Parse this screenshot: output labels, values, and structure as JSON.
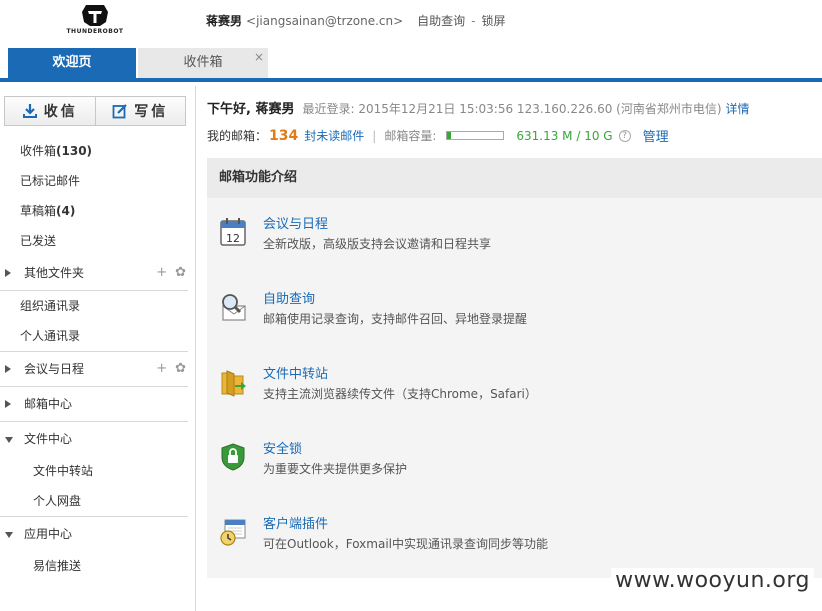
{
  "header": {
    "logo_text": "THUNDEROBOT",
    "user_name": "蒋赛男",
    "user_email": "<jiangsainan@trzone.cn>",
    "link_selfquery": "自助查询",
    "separator": "-",
    "link_lock": "锁屏"
  },
  "tabs": {
    "welcome": "欢迎页",
    "inbox": "收件箱",
    "close": "×"
  },
  "sidebar": {
    "receive_label": "收信",
    "write_label": "写信",
    "inbox_label": "收件箱",
    "inbox_count": "(130)",
    "starred": "已标记邮件",
    "drafts_label": "草稿箱",
    "drafts_count": "(4)",
    "sent": "已发送",
    "other_folders": "其他文件夹",
    "org_contacts": "组织通讯录",
    "personal_contacts": "个人通讯录",
    "meetings": "会议与日程",
    "mail_center": "邮箱中心",
    "file_center": "文件中心",
    "file_transfer": "文件中转站",
    "personal_disk": "个人网盘",
    "app_center": "应用中心",
    "yixin_push": "易信推送",
    "add_icon": "+",
    "gear_icon": "✿"
  },
  "main": {
    "greeting": "下午好, 蒋赛男",
    "last_login": "最近登录: 2015年12月21日 15:03:56 123.160.226.60 (河南省郑州市电信)",
    "detail_link": "详情",
    "mailbox_label": "我的邮箱：",
    "unread_count": "134",
    "unread_label": "封未读邮件",
    "bar": "|",
    "capacity_label": "邮箱容量:",
    "capacity_fraction": 0.062,
    "capacity_text": "631.13 M / 10 G",
    "help": "?",
    "manage_link": "管理",
    "panel_title": "邮箱功能介绍",
    "features": [
      {
        "title": "会议与日程",
        "desc": "全新改版，高级版支持会议邀请和日程共享",
        "icon": "calendar-icon"
      },
      {
        "title": "自助查询",
        "desc": "邮箱使用记录查询，支持邮件召回、异地登录提醒",
        "icon": "magnifier-mail-icon"
      },
      {
        "title": "文件中转站",
        "desc": "支持主流浏览器续传文件（支持Chrome，Safari）",
        "icon": "folder-arrow-icon"
      },
      {
        "title": "安全锁",
        "desc": "为重要文件夹提供更多保护",
        "icon": "shield-lock-icon"
      },
      {
        "title": "客户端插件",
        "desc": "可在Outlook，Foxmail中实现通讯录查询同步等功能",
        "icon": "calendar-clock-icon"
      }
    ]
  },
  "watermark": "www.wooyun.org",
  "colors": {
    "accent": "#1a6ab5",
    "orange": "#e07b16",
    "green": "#3aa53a"
  }
}
